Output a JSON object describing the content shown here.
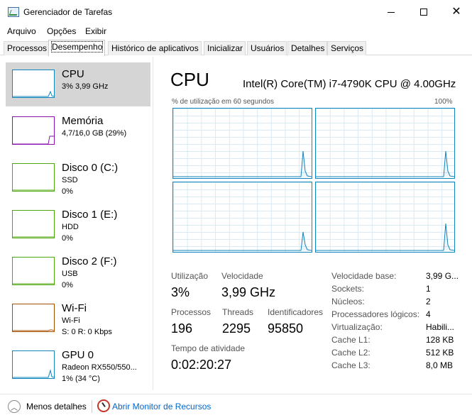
{
  "window": {
    "title": "Gerenciador de Tarefas"
  },
  "menu": [
    "Arquivo",
    "Opções",
    "Exibir"
  ],
  "tabs": [
    {
      "label": "Processos",
      "active": false
    },
    {
      "label": "Desempenho",
      "active": true
    },
    {
      "label": "Histórico de aplicativos",
      "active": false
    },
    {
      "label": "Inicializar",
      "active": false
    },
    {
      "label": "Usuários",
      "active": false
    },
    {
      "label": "Detalhes",
      "active": false
    },
    {
      "label": "Serviços",
      "active": false
    }
  ],
  "sidebar": {
    "items": [
      {
        "name": "CPU",
        "line1": "3% 3,99 GHz",
        "line2": "",
        "color": "#1185bd",
        "selected": true,
        "icon": "cpu-graph-icon",
        "level": 0.2
      },
      {
        "name": "Memória",
        "line1": "4,7/16,0 GB (29%)",
        "line2": "",
        "color": "#8b12ae",
        "selected": false,
        "icon": "memory-graph-icon",
        "level": 0.29
      },
      {
        "name": "Disco 0 (C:)",
        "line1": "SSD",
        "line2": "0%",
        "color": "#4da60c",
        "selected": false,
        "icon": "disk-graph-icon",
        "level": 0
      },
      {
        "name": "Disco 1 (E:)",
        "line1": "HDD",
        "line2": "0%",
        "color": "#4da60c",
        "selected": false,
        "icon": "disk-graph-icon",
        "level": 0
      },
      {
        "name": "Disco 2 (F:)",
        "line1": "USB",
        "line2": "0%",
        "color": "#4da60c",
        "selected": false,
        "icon": "disk-graph-icon",
        "level": 0
      },
      {
        "name": "Wi-Fi",
        "line1": "Wi-Fi",
        "line2": "S: 0 R: 0 Kbps",
        "color": "#a74f01",
        "selected": false,
        "icon": "network-graph-icon",
        "level": 0.05
      },
      {
        "name": "GPU 0",
        "line1": "Radeon RX550/550...",
        "line2": "1% (34 °C)",
        "color": "#1185bd",
        "selected": false,
        "icon": "gpu-graph-icon",
        "level": 0.3
      }
    ]
  },
  "main": {
    "title": "CPU",
    "model": "Intel(R) Core(TM) i7-4790K CPU @ 4.00GHz",
    "graph_label": "% de utilização em 60 segundos",
    "graph_max": "100%",
    "stats": {
      "utilizacao_label": "Utilização",
      "utilizacao_value": "3%",
      "velocidade_label": "Velocidade",
      "velocidade_value": "3,99 GHz",
      "processos_label": "Processos",
      "processos_value": "196",
      "threads_label": "Threads",
      "threads_value": "2295",
      "identificadores_label": "Identificadores",
      "identificadores_value": "95850",
      "tempo_label": "Tempo de atividade",
      "tempo_value": "0:02:20:27"
    },
    "properties": [
      {
        "label": "Velocidade base:",
        "value": "3,99 G..."
      },
      {
        "label": "Sockets:",
        "value": "1"
      },
      {
        "label": "Núcleos:",
        "value": "2"
      },
      {
        "label": "Processadores lógicos:",
        "value": "4"
      },
      {
        "label": "Virtualização:",
        "value": "Habili..."
      },
      {
        "label": "Cache L1:",
        "value": "128 KB"
      },
      {
        "label": "Cache L2:",
        "value": "512 KB"
      },
      {
        "label": "Cache L3:",
        "value": "8,0 MB"
      }
    ]
  },
  "footer": {
    "less_details": "Menos detalhes",
    "resource_monitor": "Abrir Monitor de Recursos"
  },
  "colors": {
    "cpu": "#1185bd",
    "memory": "#8b12ae",
    "disk": "#4da60c",
    "network": "#a74f01",
    "link": "#0066cc"
  }
}
